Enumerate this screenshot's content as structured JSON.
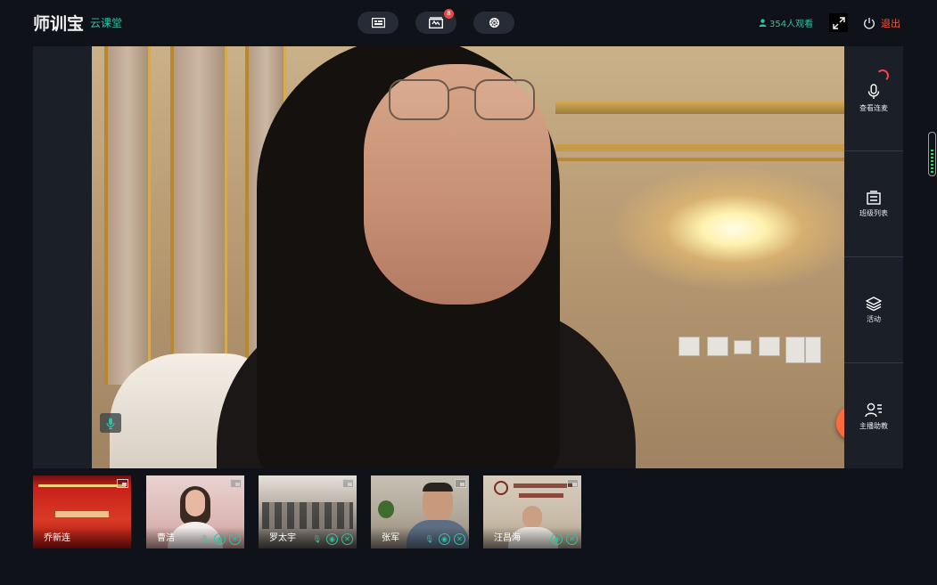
{
  "app": {
    "logo_text": "师训宝",
    "logo_subtitle": "云课堂"
  },
  "toolbar": {
    "buttons": [
      {
        "name": "courseware-button",
        "icon": "board-icon"
      },
      {
        "name": "media-button",
        "icon": "film-icon",
        "badge": "8"
      },
      {
        "name": "settings-button",
        "icon": "gear-icon"
      }
    ]
  },
  "header": {
    "viewers": "354人观看",
    "logout_label": "退出"
  },
  "rail": {
    "items": [
      {
        "label": "查看连麦",
        "icon": "microphone-icon"
      },
      {
        "label": "班级列表",
        "icon": "class-list-icon"
      },
      {
        "label": "活动",
        "icon": "layers-icon"
      },
      {
        "label": "主播助教",
        "icon": "assistant-icon"
      }
    ]
  },
  "thumbnails": [
    {
      "name": "乔新连",
      "controls": false
    },
    {
      "name": "曹洁",
      "controls": true
    },
    {
      "name": "罗太宇",
      "controls": true
    },
    {
      "name": "张军",
      "controls": true
    },
    {
      "name": "汪昌海",
      "controls": true
    }
  ],
  "colors": {
    "accent": "#2ec4a3",
    "danger": "#f25a3c",
    "fab": "#ff6a3d",
    "background": "#0f1219"
  }
}
